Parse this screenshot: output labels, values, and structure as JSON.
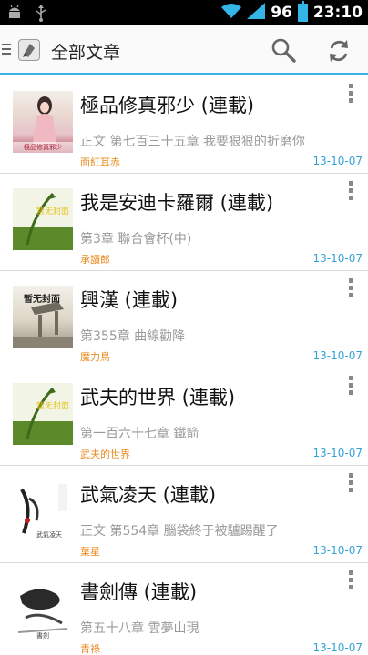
{
  "status_bar": {
    "battery": "96",
    "time": "23:10"
  },
  "action_bar": {
    "title": "全部文章"
  },
  "books": [
    {
      "title": "極品修真邪少 (連載)",
      "chapter": "正文 第七百三十五章 我要狠狠的折磨你",
      "author": "面紅耳赤",
      "date": "13-10-07",
      "cover_caption": "極品修真邪少"
    },
    {
      "title": "我是安迪卡羅爾 (連載)",
      "chapter": "第3章 聯合會杯(中)",
      "author": "承讀郎",
      "date": "13-10-07",
      "cover_caption": "暂无封面"
    },
    {
      "title": "興漢 (連載)",
      "chapter": "第355章 曲線勸降",
      "author": "魔力鳥",
      "date": "13-10-07",
      "cover_caption": "暂无封面"
    },
    {
      "title": "武夫的世界 (連載)",
      "chapter": "第一百六十七章 鐵箭",
      "author": "武夫的世界",
      "date": "13-10-07",
      "cover_caption": "暂无封面"
    },
    {
      "title": "武氣凌天 (連載)",
      "chapter": "正文 第554章 腦袋終于被驢踢醒了",
      "author": "葉星",
      "date": "13-10-07",
      "cover_caption": "武氣凌天"
    },
    {
      "title": "書劍傳 (連載)",
      "chapter": "第五十八章 雲夢山現",
      "author": "青祿",
      "date": "13-10-07",
      "cover_caption": "書劍"
    }
  ],
  "colors": {
    "accent": "#33b5e5",
    "author": "#e98a1e",
    "date": "#33a2d9"
  }
}
